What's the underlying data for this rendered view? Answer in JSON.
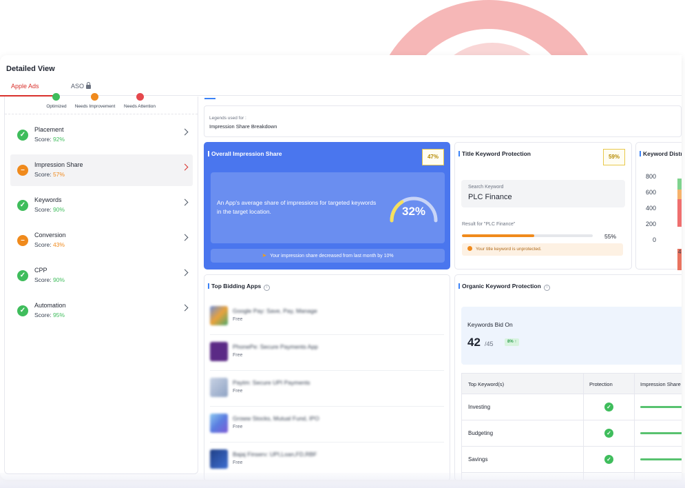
{
  "header": {
    "title": "Detailed View"
  },
  "tabs": [
    {
      "label": "Apple Ads",
      "active": true
    },
    {
      "label": "ASO",
      "locked": true
    }
  ],
  "legend": [
    {
      "label": "Optimized",
      "icon": "check-icon",
      "color": "#3fbd5c"
    },
    {
      "label": "Needs Improvement",
      "icon": "minus-icon",
      "color": "#f08a1c"
    },
    {
      "label": "Needs Attention",
      "icon": "x-icon",
      "color": "#e5484d"
    }
  ],
  "score_items": [
    {
      "name": "Placement",
      "score_label": "Score: ",
      "score": "92%",
      "status": "optimized"
    },
    {
      "name": "Impression Share",
      "score_label": "Score: ",
      "score": "57%",
      "status": "needs-improvement",
      "selected": true
    },
    {
      "name": "Keywords",
      "score_label": "Score: ",
      "score": "90%",
      "status": "optimized"
    },
    {
      "name": "Conversion",
      "score_label": "Score: ",
      "score": "43%",
      "status": "needs-improvement"
    },
    {
      "name": "CPP",
      "score_label": "Score: ",
      "score": "90%",
      "status": "optimized"
    },
    {
      "name": "Automation",
      "score_label": "Score: ",
      "score": "95%",
      "status": "optimized"
    }
  ],
  "legends_box": {
    "small": "Legends used for :",
    "main": "Impression Share Breakdown"
  },
  "impression_card": {
    "title": "Overall Impression Share",
    "badge": "47%",
    "description": "An App's average share of impressions for targeted keywords in the target location.",
    "gauge_value": "32%",
    "gauge_fraction": 0.32,
    "footer": "Your impression share decreased from last month by 10%"
  },
  "title_keyword_card": {
    "title": "Title Keyword Protection",
    "badge": "59%",
    "search_label": "Search Keyword",
    "search_value": "PLC Finance",
    "result_label": "Result for \"PLC Finance\"",
    "progress": 55,
    "progress_label": "55%",
    "warning": "Your title keyword is unprotected."
  },
  "keyword_dist_card": {
    "title": "Keyword Distribution",
    "y_ticks": [
      "800",
      "600",
      "400",
      "200",
      "0"
    ],
    "x_label": "4"
  },
  "top_bidding_card": {
    "title": "Top Bidding Apps",
    "apps": [
      {
        "name": "Google Pay: Save, Pay, Manage",
        "sub": "Free",
        "thumb": "#6f8fd8"
      },
      {
        "name": "PhonePe: Secure Payments App",
        "sub": "Free",
        "thumb": "#5b2a86"
      },
      {
        "name": "Paytm: Secure UPI Payments",
        "sub": "Free",
        "thumb": "#a9b6cf"
      },
      {
        "name": "Groww Stocks, Mutual Fund, IPO",
        "sub": "Free",
        "thumb": "#5a7de0"
      },
      {
        "name": "Bajaj Finserv: UPI,Loan,FD,RBF",
        "sub": "Free",
        "thumb": "#1f3f86"
      }
    ]
  },
  "organic_card": {
    "title": "Organic Keyword Protection",
    "bid_label": "Keywords Bid On",
    "bid_count": "42",
    "bid_total": "/45",
    "bid_badge": "8% ↑",
    "table_headers": [
      "Top Keyword(s)",
      "Protection",
      "Impression Share"
    ],
    "rows": [
      {
        "keyword": "Investing",
        "protected": true
      },
      {
        "keyword": "Budgeting",
        "protected": true
      },
      {
        "keyword": "Savings",
        "protected": true
      }
    ]
  },
  "colors": {
    "accent_red": "#d9302b",
    "accent_blue": "#4a76ee",
    "green": "#3fbd5c",
    "orange": "#f08a1c",
    "red": "#e5484d"
  }
}
